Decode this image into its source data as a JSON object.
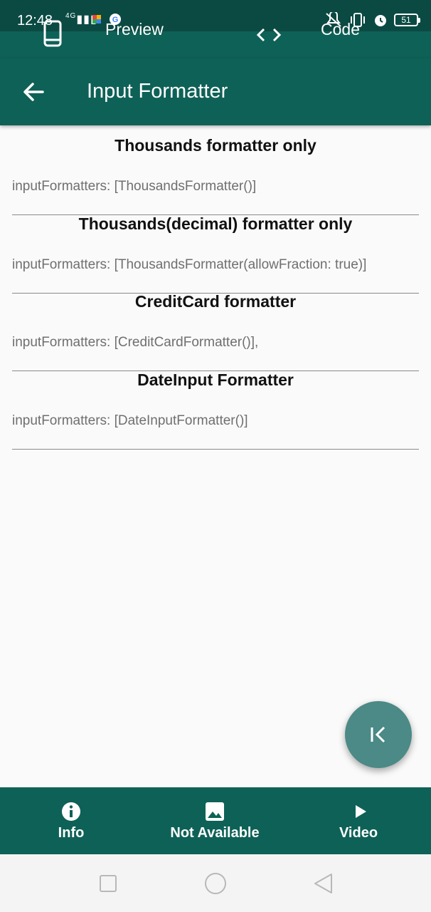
{
  "status_bar": {
    "time": "12:48",
    "signal_text": "4G",
    "battery_level": "51"
  },
  "top_tabs": [
    {
      "label": "Preview",
      "icon": "phone-icon"
    },
    {
      "label": "Code",
      "icon": "code-icon"
    }
  ],
  "appbar": {
    "title": "Input Formatter",
    "back_icon": "arrow-left-icon"
  },
  "sections": [
    {
      "title": "Thousands formatter only",
      "placeholder": "inputFormatters: [ThousandsFormatter()]"
    },
    {
      "title": "Thousands(decimal) formatter only",
      "placeholder": "inputFormatters: [ThousandsFormatter(allowFraction: true)]"
    },
    {
      "title": "CreditCard formatter",
      "placeholder": "inputFormatters: [CreditCardFormatter()],"
    },
    {
      "title": "DateInput Formatter",
      "placeholder": "inputFormatters: [DateInputFormatter()]"
    }
  ],
  "fab": {
    "icon": "first-page-icon"
  },
  "bottom_nav": [
    {
      "label": "Info",
      "icon": "info-icon"
    },
    {
      "label": "Not Available",
      "icon": "image-icon"
    },
    {
      "label": "Video",
      "icon": "play-icon"
    }
  ],
  "colors": {
    "primary": "#0e6157",
    "status_bar": "#0b4a43",
    "fab": "#4b8a86",
    "background": "#fafafa"
  }
}
